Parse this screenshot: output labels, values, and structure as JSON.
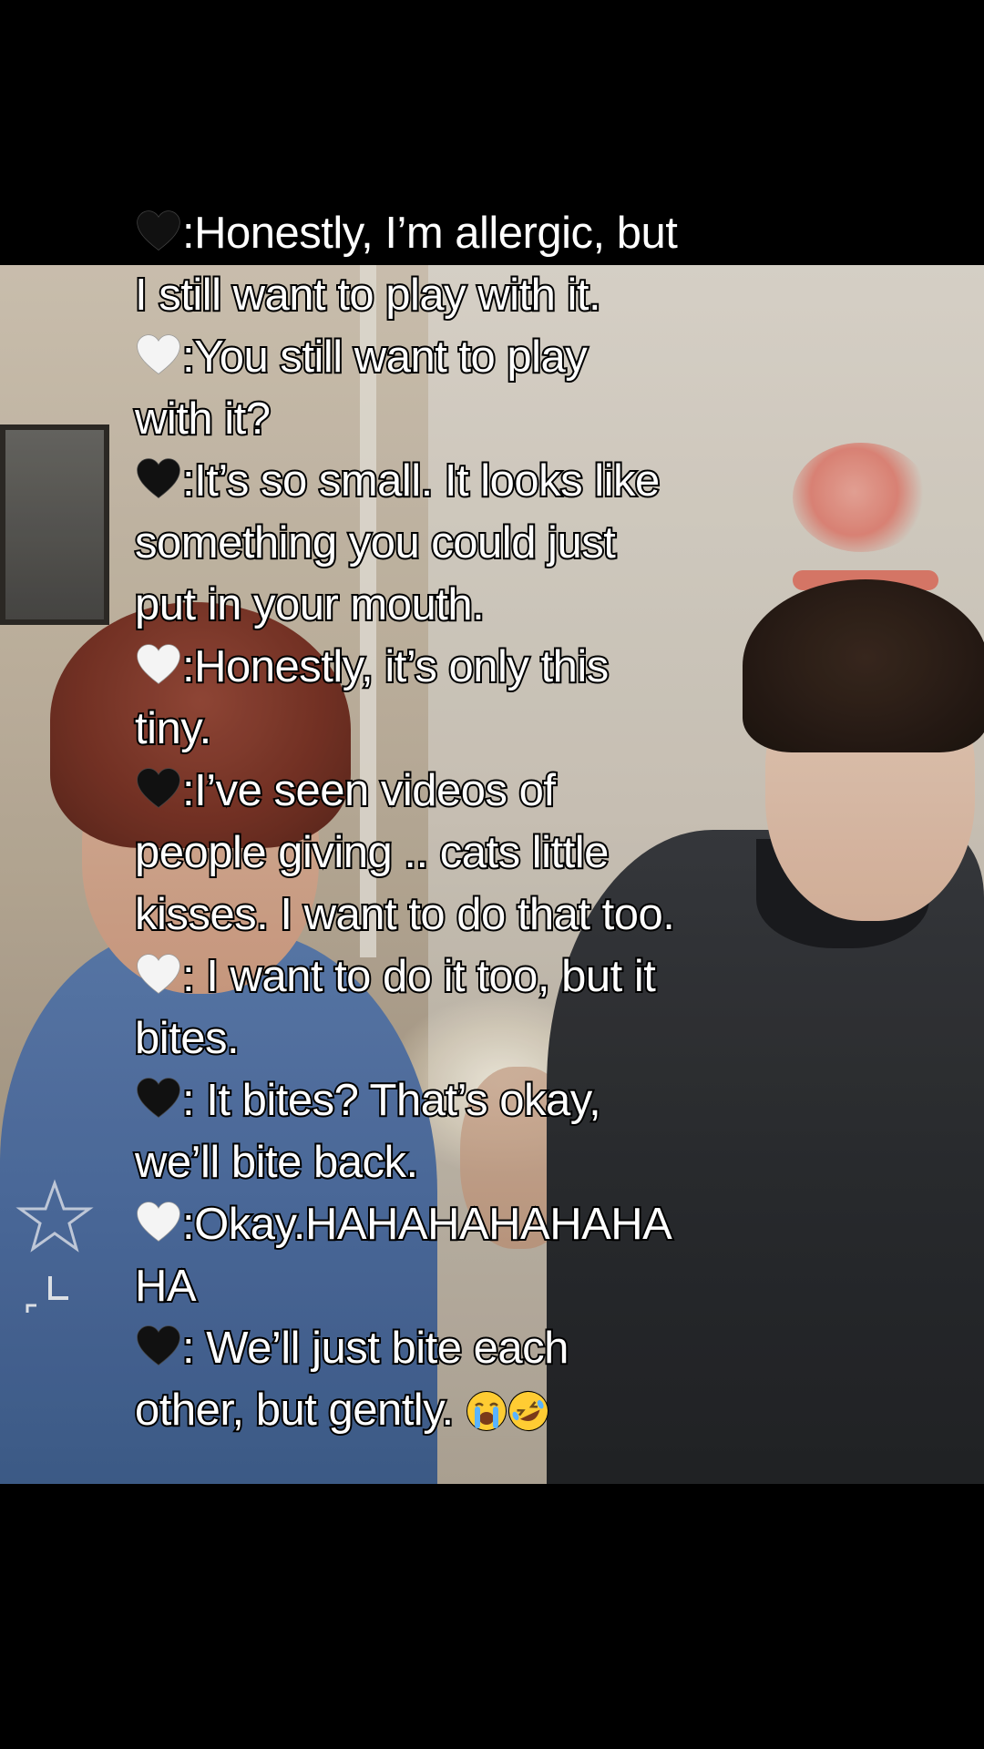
{
  "captions": [
    {
      "speaker": "black-heart",
      "text": ":Honestly, I’m allergic, but"
    },
    {
      "speaker": null,
      "text": "I still want to play with it."
    },
    {
      "speaker": "white-heart",
      "text": ":You still want to play"
    },
    {
      "speaker": null,
      "text": "with it?"
    },
    {
      "speaker": "black-heart",
      "text": ":It’s so small. It looks like"
    },
    {
      "speaker": null,
      "text": "something you could just"
    },
    {
      "speaker": null,
      "text": "put in your mouth."
    },
    {
      "speaker": "white-heart",
      "text": ":Honestly, it’s only this"
    },
    {
      "speaker": null,
      "text": "tiny."
    },
    {
      "speaker": "black-heart",
      "text": ":I’ve seen videos of"
    },
    {
      "speaker": null,
      "text": "people giving .. cats little"
    },
    {
      "speaker": null,
      "text": "kisses. I want to do that too."
    },
    {
      "speaker": "white-heart",
      "text": ": I want to do it too, but it"
    },
    {
      "speaker": null,
      "text": "bites."
    },
    {
      "speaker": "black-heart",
      "text": ": It bites? That’s okay,"
    },
    {
      "speaker": null,
      "text": "we’ll bite back."
    },
    {
      "speaker": "white-heart",
      "text": ":Okay.HAHAHAHAHAHA"
    },
    {
      "speaker": null,
      "text": "HA"
    },
    {
      "speaker": "black-heart",
      "text": ": We’ll just bite each"
    },
    {
      "speaker": null,
      "text": "other, but gently. "
    }
  ],
  "trailing_emojis": [
    "loudly-crying-face-emoji",
    "rolling-on-floor-laughing-emoji"
  ],
  "colors": {
    "background": "#000000",
    "caption_fill": "#ffffff",
    "caption_stroke": "#000000"
  }
}
